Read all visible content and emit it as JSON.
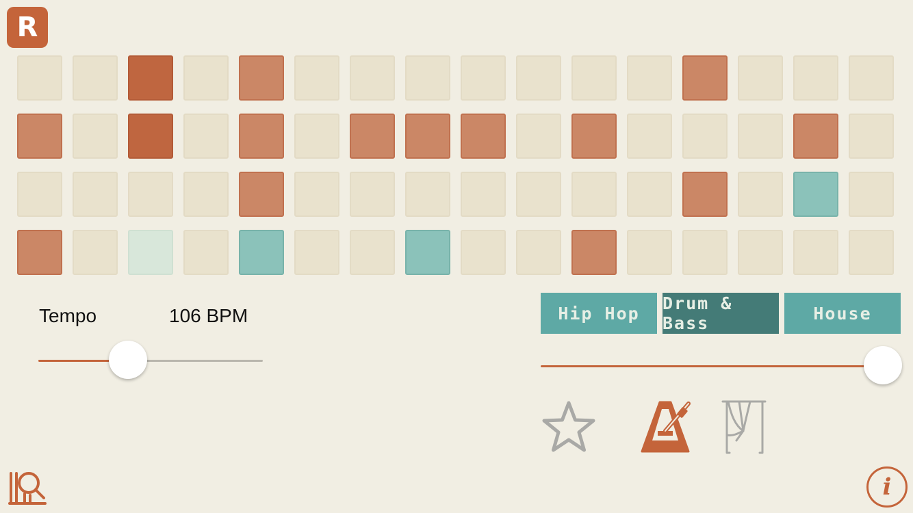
{
  "app": {
    "logo_letter": "R",
    "accent_color": "#c4643a",
    "teal_color": "#5ea9a5"
  },
  "grid": {
    "cols": 16,
    "rows": [
      [
        "off",
        "off",
        "dark",
        "off",
        "on",
        "off",
        "off",
        "off",
        "off",
        "off",
        "off",
        "off",
        "on",
        "off",
        "off",
        "off"
      ],
      [
        "on",
        "off",
        "dark",
        "off",
        "on",
        "off",
        "on",
        "on",
        "on",
        "off",
        "on",
        "off",
        "off",
        "off",
        "on",
        "off"
      ],
      [
        "off",
        "off",
        "off",
        "off",
        "on",
        "off",
        "off",
        "off",
        "off",
        "off",
        "off",
        "off",
        "on",
        "off",
        "teal",
        "off"
      ],
      [
        "on",
        "off",
        "mint",
        "off",
        "teal",
        "off",
        "off",
        "teal",
        "off",
        "off",
        "on",
        "off",
        "off",
        "off",
        "off",
        "off"
      ]
    ]
  },
  "tempo": {
    "label": "Tempo",
    "value_text": "106 BPM",
    "slider_fraction": 0.4
  },
  "genres": {
    "items": [
      {
        "label": "Hip Hop",
        "active": false
      },
      {
        "label": "Drum & Bass",
        "active": true
      },
      {
        "label": "House",
        "active": false
      }
    ],
    "morph_slider_fraction": 1.0
  },
  "toolbar": {
    "icons": [
      "star-icon",
      "metronome-icon",
      "curtain-icon",
      "library-search-icon",
      "info-icon"
    ],
    "info_label": "i"
  }
}
